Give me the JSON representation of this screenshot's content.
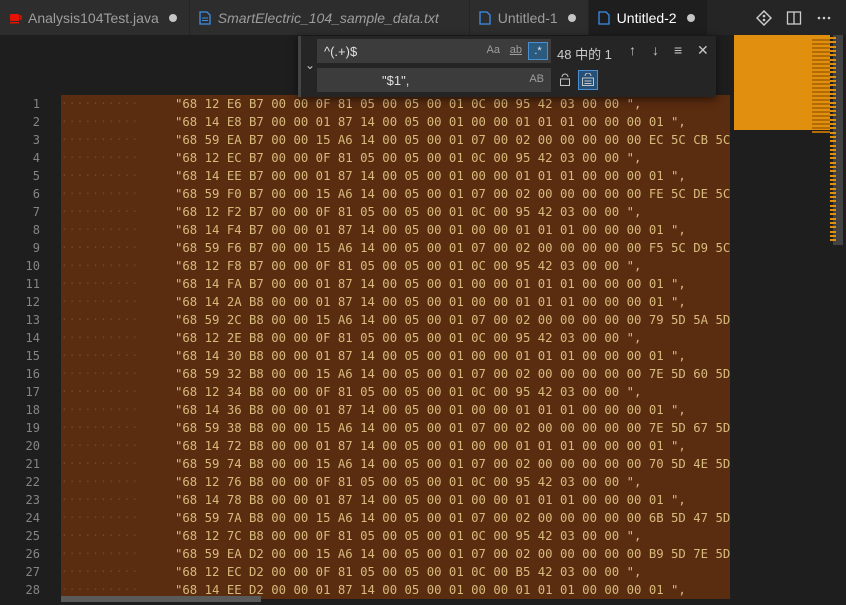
{
  "tabs": [
    {
      "label": "Analysis104Test.java",
      "icon": "java-icon",
      "dirty": true,
      "active": false,
      "italic": false
    },
    {
      "label": "SmartElectric_104_sample_data.txt",
      "icon": "file-icon",
      "dirty": false,
      "active": false,
      "italic": true
    },
    {
      "label": "Untitled-1",
      "icon": "file-icon",
      "dirty": true,
      "active": false,
      "italic": false
    },
    {
      "label": "Untitled-2",
      "icon": "file-icon",
      "dirty": true,
      "active": true,
      "italic": false
    }
  ],
  "find": {
    "search_value": "^(.+)$",
    "replace_value": "\"$1\",",
    "match_case_label": "Aa",
    "whole_word_label": "ab",
    "regex_label": ".*",
    "preserve_case_label": "AB",
    "result_count": "48 中的 1"
  },
  "lines": [
    {
      "n": "1",
      "text": "\"68 12 E6 B7 00 00 0F 81 05 00 05 00 01 0C 00 95 42 03 00 00 \","
    },
    {
      "n": "2",
      "text": "\"68 14 E8 B7 00 00 01 87 14 00 05 00 01 00 00 01 01 01 00 00 00 01 \","
    },
    {
      "n": "3",
      "text": "\"68 59 EA B7 00 00 15 A6 14 00 05 00 01 07 00 02 00 00 00 00 00 EC 5C CB 5C D"
    },
    {
      "n": "4",
      "text": "\"68 12 EC B7 00 00 0F 81 05 00 05 00 01 0C 00 95 42 03 00 00 \","
    },
    {
      "n": "5",
      "text": "\"68 14 EE B7 00 00 01 87 14 00 05 00 01 00 00 01 01 01 00 00 00 01 \","
    },
    {
      "n": "6",
      "text": "\"68 59 F0 B7 00 00 15 A6 14 00 05 00 01 07 00 02 00 00 00 00 00 FE 5C DE 5C F"
    },
    {
      "n": "7",
      "text": "\"68 12 F2 B7 00 00 0F 81 05 00 05 00 01 0C 00 95 42 03 00 00 \","
    },
    {
      "n": "8",
      "text": "\"68 14 F4 B7 00 00 01 87 14 00 05 00 01 00 00 01 01 01 00 00 00 01 \","
    },
    {
      "n": "9",
      "text": "\"68 59 F6 B7 00 00 15 A6 14 00 05 00 01 07 00 02 00 00 00 00 00 F5 5C D9 5C E"
    },
    {
      "n": "10",
      "text": "\"68 12 F8 B7 00 00 0F 81 05 00 05 00 01 0C 00 95 42 03 00 00 \","
    },
    {
      "n": "11",
      "text": "\"68 14 FA B7 00 00 01 87 14 00 05 00 01 00 00 01 01 01 00 00 00 01 \","
    },
    {
      "n": "12",
      "text": "\"68 14 2A B8 00 00 01 87 14 00 05 00 01 00 00 01 01 01 00 00 00 01 \","
    },
    {
      "n": "13",
      "text": "\"68 59 2C B8 00 00 15 A6 14 00 05 00 01 07 00 02 00 00 00 00 00 79 5D 5A 5D 6"
    },
    {
      "n": "14",
      "text": "\"68 12 2E B8 00 00 0F 81 05 00 05 00 01 0C 00 95 42 03 00 00 \","
    },
    {
      "n": "15",
      "text": "\"68 14 30 B8 00 00 01 87 14 00 05 00 01 00 00 01 01 01 00 00 00 01 \","
    },
    {
      "n": "16",
      "text": "\"68 59 32 B8 00 00 15 A6 14 00 05 00 01 07 00 02 00 00 00 00 00 7E 5D 60 5D 6"
    },
    {
      "n": "17",
      "text": "\"68 12 34 B8 00 00 0F 81 05 00 05 00 01 0C 00 95 42 03 00 00 \","
    },
    {
      "n": "18",
      "text": "\"68 14 36 B8 00 00 01 87 14 00 05 00 01 00 00 01 01 01 00 00 00 01 \","
    },
    {
      "n": "19",
      "text": "\"68 59 38 B8 00 00 15 A6 14 00 05 00 01 07 00 02 00 00 00 00 00 7E 5D 67 5D 7"
    },
    {
      "n": "20",
      "text": "\"68 14 72 B8 00 00 01 87 14 00 05 00 01 00 00 01 01 01 00 00 00 01 \","
    },
    {
      "n": "21",
      "text": "\"68 59 74 B8 00 00 15 A6 14 00 05 00 01 07 00 02 00 00 00 00 00 70 5D 4E 5D 4"
    },
    {
      "n": "22",
      "text": "\"68 12 76 B8 00 00 0F 81 05 00 05 00 01 0C 00 95 42 03 00 00 \","
    },
    {
      "n": "23",
      "text": "\"68 14 78 B8 00 00 01 87 14 00 05 00 01 00 00 01 01 01 00 00 00 01 \","
    },
    {
      "n": "24",
      "text": "\"68 59 7A B8 00 00 15 A6 14 00 05 00 01 07 00 02 00 00 00 00 00 6B 5D 47 5D 6"
    },
    {
      "n": "25",
      "text": "\"68 12 7C B8 00 00 0F 81 05 00 05 00 01 0C 00 95 42 03 00 00 \","
    },
    {
      "n": "26",
      "text": "\"68 59 EA D2 00 00 15 A6 14 00 05 00 01 07 00 02 00 00 00 00 00 B9 5D 7E 5D 9"
    },
    {
      "n": "27",
      "text": "\"68 12 EC D2 00 00 0F 81 05 00 05 00 01 0C 00 B5 42 03 00 00 \","
    },
    {
      "n": "28",
      "text": "\"68 14 EE D2 00 00 01 87 14 00 05 00 01 00 00 01 01 01 00 00 00 01 \","
    }
  ],
  "colors": {
    "selection_highlight": "#5a2c10",
    "minimap_slider": "#e0900e",
    "string_text": "#d7ba7d"
  }
}
